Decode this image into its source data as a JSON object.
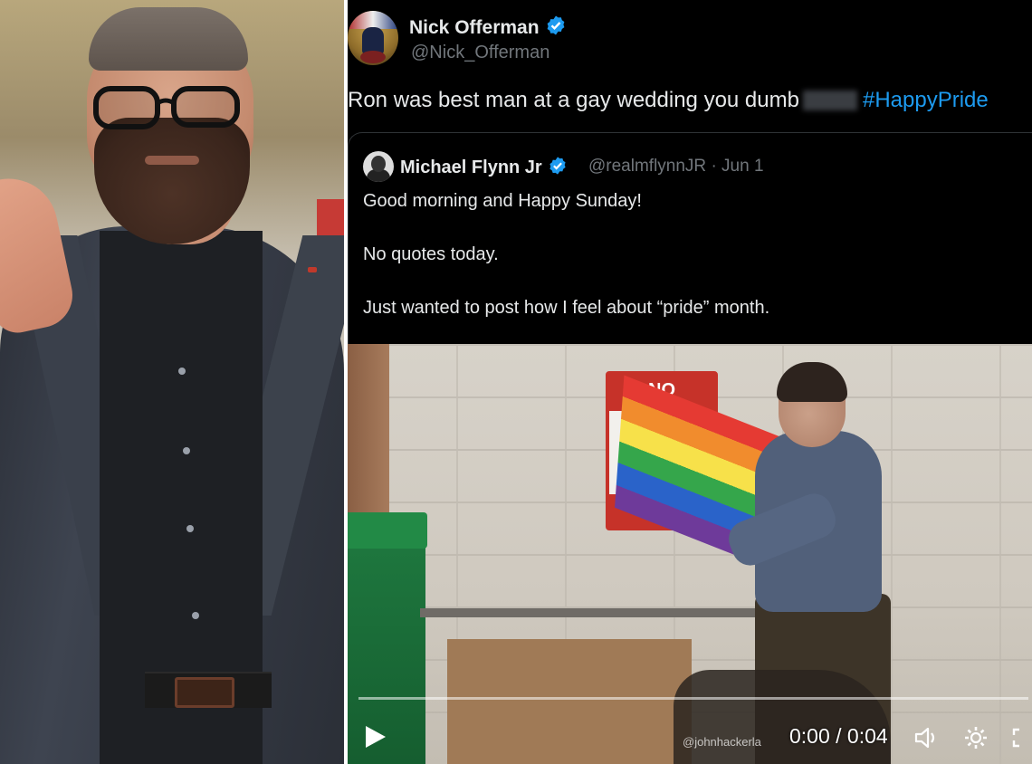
{
  "tweet": {
    "author_name": "Nick Offerman",
    "author_handle": "@Nick_Offerman",
    "text_before": "Ron was best man at a gay wedding you dumb",
    "hashtag": "#HappyPride",
    "accent_color": "#1d9bf0"
  },
  "quoted_tweet": {
    "author_name": "Michael Flynn Jr",
    "author_handle": "@realmflynnJR",
    "date": "· Jun 1",
    "lines": [
      "Good morning and Happy Sunday!",
      "No quotes today.",
      "Just wanted to post how I feel about “pride” month."
    ]
  },
  "video": {
    "time": "0:00 / 0:04",
    "watermark": "@johnhackerla",
    "sign_text": "NO",
    "progress": 0
  },
  "icons": {
    "verified": "verified-badge-icon",
    "play": "play-icon",
    "volume": "volume-icon",
    "settings": "gear-icon",
    "fullscreen": "fullscreen-icon"
  }
}
